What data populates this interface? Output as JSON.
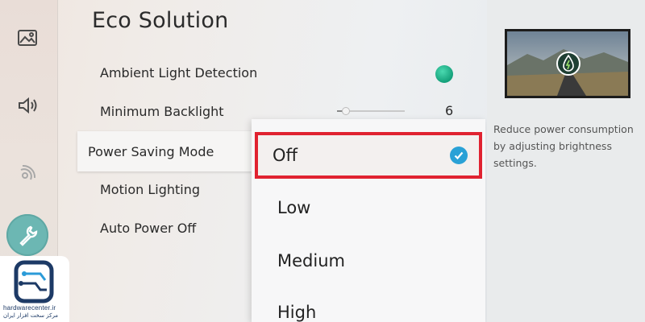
{
  "menu": {
    "title": "Eco Solution",
    "items": [
      {
        "label": "Ambient Light Detection",
        "state": "on"
      },
      {
        "label": "Minimum Backlight",
        "value": "6",
        "level": 6
      },
      {
        "label": "Power Saving Mode"
      },
      {
        "label": "Motion Lighting"
      },
      {
        "label": "Auto Power Off"
      }
    ]
  },
  "dropdown": {
    "options": [
      "Off",
      "Low",
      "Medium",
      "High"
    ],
    "selected": "Off"
  },
  "info": {
    "description": "Reduce power consumption by adjusting brightness settings."
  },
  "sidebar": {
    "icons": [
      "picture-icon",
      "sound-icon",
      "broadcast-icon",
      "support-wrench-icon"
    ],
    "active": "support-wrench-icon"
  },
  "watermark": {
    "site": "hardwarecenter.ir",
    "tagline": "مرکز سخت افزار ایران"
  },
  "colors": {
    "selection_outline": "#e02230",
    "toggle_on": "#14a07a",
    "check": "#2aa1d6",
    "active_icon_bg": "#6cb7b3"
  }
}
